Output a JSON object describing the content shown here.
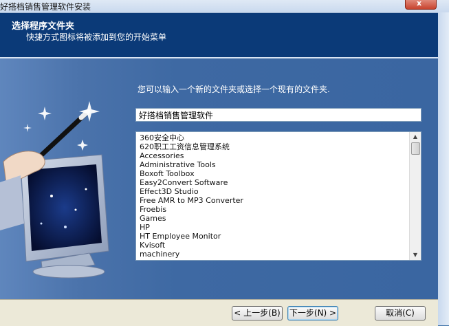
{
  "window": {
    "title": "好搭档销售管理软件安装",
    "close_label": "x"
  },
  "header": {
    "title": "选择程序文件夹",
    "subtitle": "快捷方式图标将被添加到您的开始菜单"
  },
  "main": {
    "prompt": "您可以输入一个新的文件夹或选择一个现有的文件夹.",
    "folder_value": "好搭档销售管理软件",
    "folders": [
      "360安全中心",
      "620职工工资信息管理系统",
      "Accessories",
      "Administrative Tools",
      "Boxoft Toolbox",
      "Easy2Convert Software",
      "Effect3D Studio",
      "Free AMR to MP3 Converter",
      "Froebis",
      "Games",
      "HP",
      "HT Employee Monitor",
      "Kvisoft",
      "machinery"
    ]
  },
  "footer": {
    "back_label": "< 上一步(B)",
    "next_label": "下一步(N) >",
    "cancel_label": "取消(C)"
  },
  "icons": [
    "magic-wand-icon",
    "monitor-icon",
    "scroll-up-icon",
    "scroll-down-icon"
  ]
}
